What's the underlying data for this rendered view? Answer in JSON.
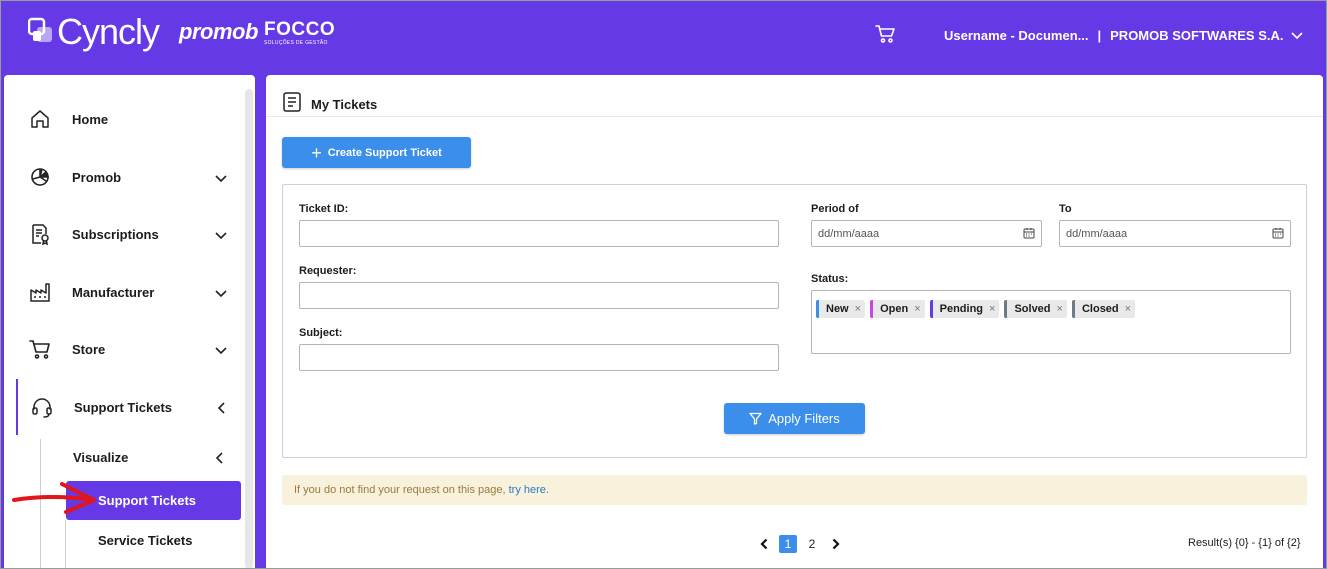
{
  "header": {
    "brand": "Cyncly",
    "brand2": "promob",
    "brand3": "FOCCO",
    "brand3_sub": "SOLUÇÕES DE GESTÃO",
    "username": "Username - Documen...",
    "separator": "|",
    "company": "PROMOB SOFTWARES S.A."
  },
  "sidebar": {
    "items": [
      {
        "label": "Home",
        "icon": "home-icon"
      },
      {
        "label": "Promob",
        "icon": "promob-icon"
      },
      {
        "label": "Subscriptions",
        "icon": "subscriptions-icon"
      },
      {
        "label": "Manufacturer",
        "icon": "factory-icon"
      },
      {
        "label": "Store",
        "icon": "cart-icon"
      },
      {
        "label": "Support Tickets",
        "icon": "headset-icon"
      }
    ],
    "sub_group": "Visualize",
    "sub_items": [
      {
        "label": "Support Tickets",
        "active": true
      },
      {
        "label": "Service Tickets",
        "active": false
      }
    ]
  },
  "main": {
    "title": "My Tickets",
    "create_button": "Create Support Ticket",
    "filters": {
      "ticket_id_label": "Ticket ID:",
      "requester_label": "Requester:",
      "subject_label": "Subject:",
      "period_label": "Period of",
      "to_label": "To",
      "date_placeholder": "dd/mm/aaaa",
      "status_label": "Status:",
      "status_tags": [
        {
          "label": "New",
          "color": "#3b8eea"
        },
        {
          "label": "Open",
          "color": "#c546e0"
        },
        {
          "label": "Pending",
          "color": "#6539e6"
        },
        {
          "label": "Solved",
          "color": "#6c7a89"
        },
        {
          "label": "Closed",
          "color": "#6c7a89"
        }
      ],
      "tag_remove": "×",
      "apply_button": "Apply Filters"
    },
    "notice_text": "If you do not find your request on this page,",
    "notice_link": "try here.",
    "pagination": {
      "pages": [
        "1",
        "2"
      ],
      "current": "1",
      "results": "Result(s) {0} - {1} of {2}"
    }
  },
  "colors": {
    "brand": "#6539e6",
    "primary_button": "#3b8eea",
    "notice_bg": "#f8f1dc"
  }
}
